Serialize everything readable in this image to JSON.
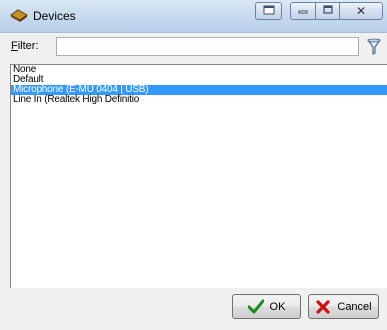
{
  "window": {
    "title": "Devices"
  },
  "filter": {
    "label_underlined": "F",
    "label_rest": "ilter:",
    "value": ""
  },
  "devices": {
    "items": [
      {
        "label": "None",
        "selected": false
      },
      {
        "label": "Default",
        "selected": false
      },
      {
        "label": "Microphone (E-MU 0404 | USB)",
        "selected": true
      },
      {
        "label": "Line In (Realtek High Definitio",
        "selected": false
      }
    ]
  },
  "buttons": {
    "ok_label": "OK",
    "cancel_label": "Cancel"
  },
  "icons": {
    "app": "app-logo-icon",
    "restore": "window-restore-icon",
    "minimize": "minimize-icon",
    "maximize": "maximize-icon",
    "close": "close-icon",
    "filter": "filter-funnel-icon",
    "ok": "checkmark-icon",
    "cancel": "red-x-icon"
  },
  "colors": {
    "selection": "#3399ff",
    "ok_check": "#1f8a1f",
    "cancel_x": "#cc1111"
  }
}
